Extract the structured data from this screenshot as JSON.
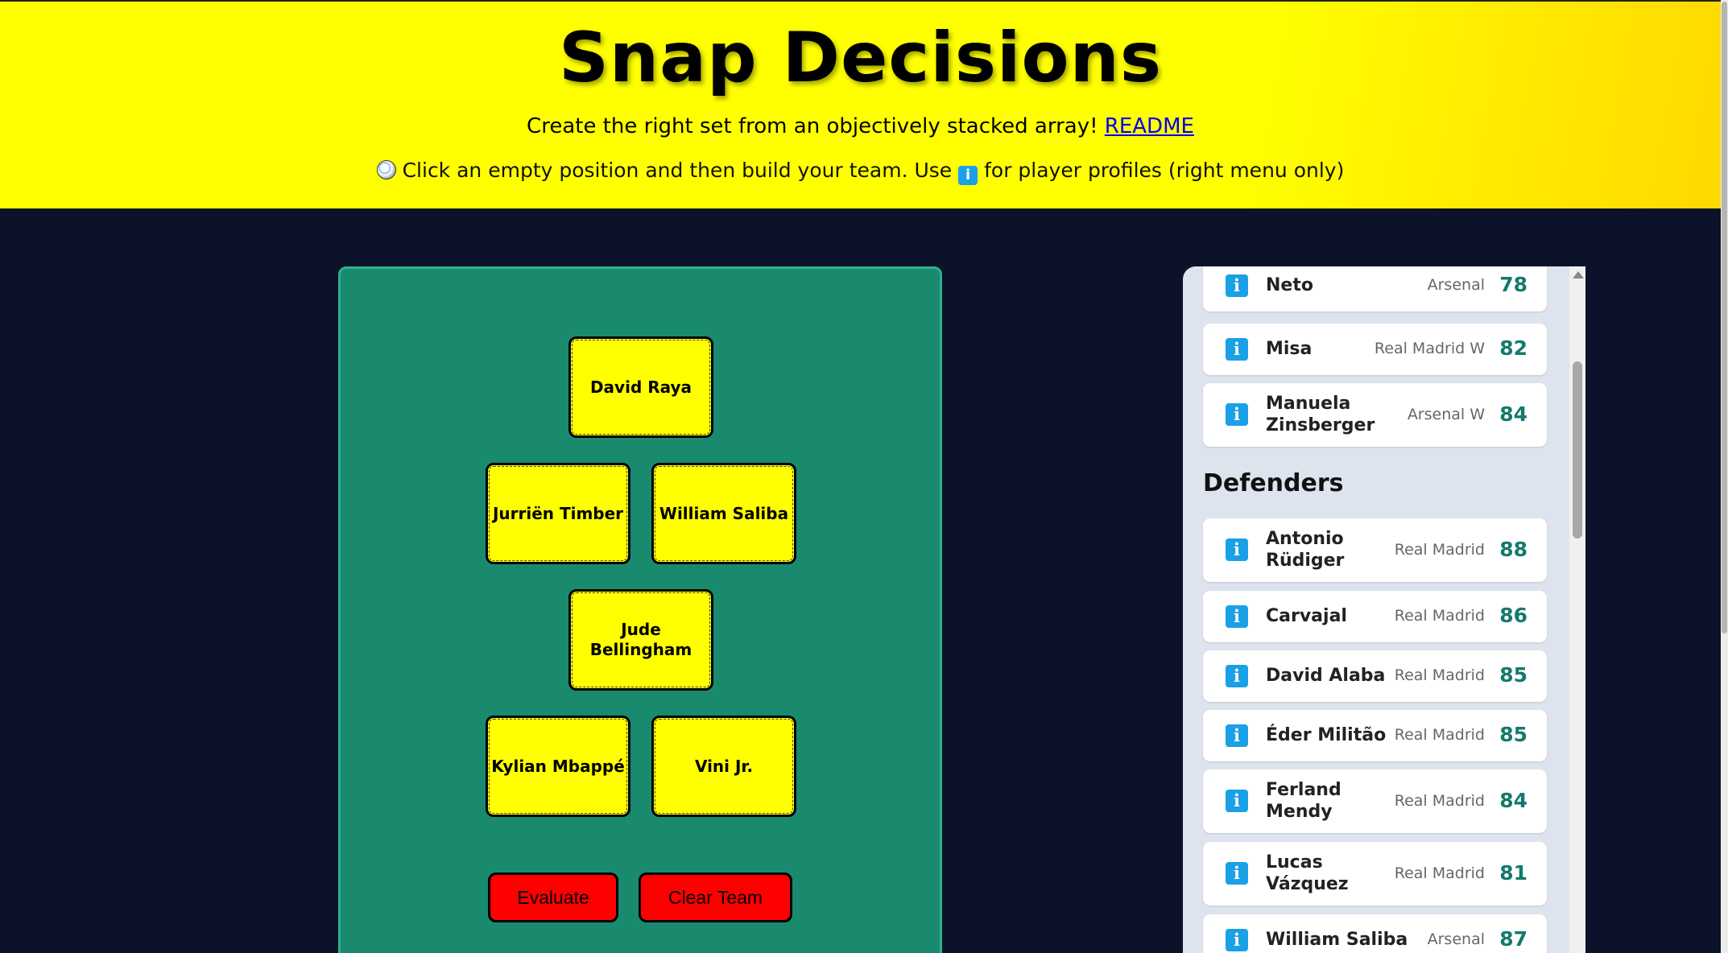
{
  "header": {
    "title": "Snap Decisions",
    "subtitle": "Create the right set from an objectively stacked array!",
    "readme_link": "README",
    "instructions_a": "Click an empty position and then build your team. Use",
    "instructions_b": "for player profiles (right menu only)",
    "ball_icon": "soccer-ball-icon",
    "info_icon": "info-icon"
  },
  "pitch": {
    "slots": [
      "David Raya",
      "Jurriën Timber",
      "William Saliba",
      "Jude Bellingham",
      "Kylian Mbappé",
      "Vini Jr."
    ],
    "evaluate_label": "Evaluate",
    "clear_label": "Clear Team"
  },
  "sidebar": {
    "goalkeepers": [
      {
        "name": "Neto",
        "club": "Arsenal",
        "rating": "78"
      },
      {
        "name": "Misa",
        "club": "Real Madrid W",
        "rating": "82"
      },
      {
        "name": "Manuela Zinsberger",
        "club": "Arsenal W",
        "rating": "84"
      }
    ],
    "defenders_heading": "Defenders",
    "defenders": [
      {
        "name": "Antonio Rüdiger",
        "club": "Real Madrid",
        "rating": "88"
      },
      {
        "name": "Carvajal",
        "club": "Real Madrid",
        "rating": "86"
      },
      {
        "name": "David Alaba",
        "club": "Real Madrid",
        "rating": "85"
      },
      {
        "name": "Éder Militão",
        "club": "Real Madrid",
        "rating": "85"
      },
      {
        "name": "Ferland Mendy",
        "club": "Real Madrid",
        "rating": "84"
      },
      {
        "name": "Lucas Vázquez",
        "club": "Real Madrid",
        "rating": "81"
      },
      {
        "name": "William Saliba",
        "club": "Arsenal",
        "rating": "87"
      }
    ],
    "info_glyph": "i"
  },
  "colors": {
    "header_bg": "#ffff00",
    "page_bg": "#0b1229",
    "pitch": "#1a8a6e",
    "slot": "#ffff00",
    "button": "#ff0000",
    "rating": "#137a6c",
    "info": "#1aa0e6"
  }
}
